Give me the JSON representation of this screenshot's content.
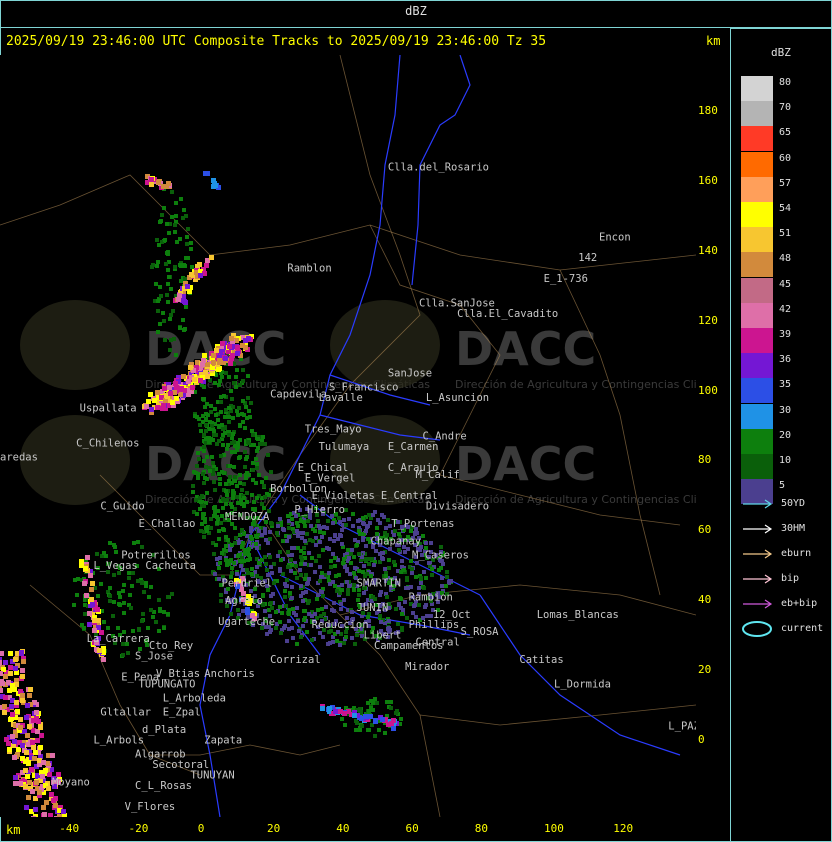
{
  "window": {
    "title": "dBZ"
  },
  "header": {
    "text": "2025/09/19 23:46:00 UTC Composite Tracks to 2025/09/19 23:46:00 Tz 35",
    "km_top": "km",
    "km_bottom": "km"
  },
  "axes": {
    "y_ticks": [
      "180",
      "160",
      "140",
      "120",
      "100",
      "80",
      "60",
      "40",
      "20",
      "0"
    ],
    "x_ticks": [
      "-40",
      "-20",
      "0",
      "20",
      "40",
      "60",
      "80",
      "100",
      "120"
    ]
  },
  "legend": {
    "title": "dBZ",
    "items": [
      {
        "label": "80",
        "color": "#d3d3d3"
      },
      {
        "label": "70",
        "color": "#b4b4b4"
      },
      {
        "label": "65",
        "color": "#ff3a26"
      },
      {
        "label": "60",
        "color": "#ff6a00"
      },
      {
        "label": "57",
        "color": "#ff9f5a"
      },
      {
        "label": "54",
        "color": "#ffff00"
      },
      {
        "label": "51",
        "color": "#f7c630"
      },
      {
        "label": "48",
        "color": "#d28a3c"
      },
      {
        "label": "45",
        "color": "#c26a86"
      },
      {
        "label": "42",
        "color": "#de6fa8"
      },
      {
        "label": "39",
        "color": "#cc1590"
      },
      {
        "label": "36",
        "color": "#7417d4"
      },
      {
        "label": "35",
        "color": "#2c4fe6"
      },
      {
        "label": "30",
        "color": "#1f92e6"
      },
      {
        "label": "20",
        "color": "#0d7f0d"
      },
      {
        "label": "10",
        "color": "#0a5f0a"
      },
      {
        "label": "5",
        "color": "#4b3f8f"
      }
    ],
    "tracks": [
      {
        "label": "50YD",
        "color": "#5fd7e6"
      },
      {
        "label": "30HM",
        "color": "#ffffff"
      },
      {
        "label": "eburn",
        "color": "#f2c88a"
      },
      {
        "label": "bip",
        "color": "#ffc6d6"
      },
      {
        "label": "eb+bip",
        "color": "#d05adc"
      },
      {
        "label": "current",
        "color": "#5fe6f0"
      }
    ]
  },
  "places": [
    {
      "name": "Clla.del_Rosario",
      "x": 52,
      "y": 163
    },
    {
      "name": "Encon",
      "x": 113,
      "y": 143
    },
    {
      "name": "142",
      "x": 107,
      "y": 137
    },
    {
      "name": "E_1-736",
      "x": 97,
      "y": 131
    },
    {
      "name": "Ramblon",
      "x": 23,
      "y": 134
    },
    {
      "name": "Clla.SanJose",
      "x": 61,
      "y": 124
    },
    {
      "name": "Clla.El_Cavadito",
      "x": 72,
      "y": 121
    },
    {
      "name": "SanJose",
      "x": 52,
      "y": 104
    },
    {
      "name": "S_Francisco",
      "x": 35,
      "y": 100
    },
    {
      "name": "L_Asuncion",
      "x": 63,
      "y": 97
    },
    {
      "name": "Lavalle",
      "x": 32,
      "y": 97
    },
    {
      "name": "Capdevila",
      "x": 18,
      "y": 98
    },
    {
      "name": "Uspallata",
      "x": -37,
      "y": 94
    },
    {
      "name": "Tres_Mayo",
      "x": 28,
      "y": 88
    },
    {
      "name": "C_Andre",
      "x": 62,
      "y": 86
    },
    {
      "name": "E_Carmen",
      "x": 52,
      "y": 83
    },
    {
      "name": "Tulumaya",
      "x": 32,
      "y": 83
    },
    {
      "name": "C_Chilenos",
      "x": -38,
      "y": 84
    },
    {
      "name": "C_Araujo",
      "x": 52,
      "y": 77
    },
    {
      "name": "E_Chical",
      "x": 26,
      "y": 77
    },
    {
      "name": "E_Vergel",
      "x": 28,
      "y": 74
    },
    {
      "name": "M_Calif",
      "x": 60,
      "y": 75
    },
    {
      "name": "Borbollon",
      "x": 18,
      "y": 71
    },
    {
      "name": "E_Violetas",
      "x": 30,
      "y": 69
    },
    {
      "name": "E_Central",
      "x": 50,
      "y": 69
    },
    {
      "name": "Divisadero",
      "x": 63,
      "y": 66
    },
    {
      "name": "MENDOZA",
      "x": 5,
      "y": 63
    },
    {
      "name": "P_Hierro",
      "x": 25,
      "y": 65
    },
    {
      "name": "C_Guido",
      "x": -31,
      "y": 66
    },
    {
      "name": "E_Challao",
      "x": -20,
      "y": 61
    },
    {
      "name": "T_Portenas",
      "x": 53,
      "y": 61
    },
    {
      "name": "Chapanay",
      "x": 47,
      "y": 56
    },
    {
      "name": "M_Caseros",
      "x": 59,
      "y": 52
    },
    {
      "name": "Potrerillos",
      "x": -25,
      "y": 52
    },
    {
      "name": "L_Vegas",
      "x": -33,
      "y": 49
    },
    {
      "name": "Cacheuta",
      "x": -18,
      "y": 49
    },
    {
      "name": "SMARTIN",
      "x": 43,
      "y": 44
    },
    {
      "name": "Perdriel",
      "x": 4,
      "y": 44
    },
    {
      "name": "Agrelo",
      "x": 5,
      "y": 39
    },
    {
      "name": "Rambion",
      "x": 58,
      "y": 40
    },
    {
      "name": "JUNIN",
      "x": 43,
      "y": 37
    },
    {
      "name": "Lomas_Blancas",
      "x": 95,
      "y": 35
    },
    {
      "name": "Phillips",
      "x": 58,
      "y": 32
    },
    {
      "name": "Ugarteche",
      "x": 3,
      "y": 33
    },
    {
      "name": "12_Oct",
      "x": 65,
      "y": 35
    },
    {
      "name": "S_ROSA",
      "x": 73,
      "y": 30
    },
    {
      "name": "Reduccion",
      "x": 30,
      "y": 32
    },
    {
      "name": "Libert",
      "x": 45,
      "y": 29
    },
    {
      "name": "Campamentos",
      "x": 48,
      "y": 26
    },
    {
      "name": "Central",
      "x": 60,
      "y": 27
    },
    {
      "name": "La_Carrera",
      "x": -35,
      "y": 28
    },
    {
      "name": "Cto_Rey",
      "x": -17,
      "y": 26
    },
    {
      "name": "S_Jose",
      "x": -21,
      "y": 23
    },
    {
      "name": "Catitas",
      "x": 90,
      "y": 22
    },
    {
      "name": "Corrizal",
      "x": 18,
      "y": 22
    },
    {
      "name": "Mirador",
      "x": 57,
      "y": 20
    },
    {
      "name": "Anchoris",
      "x": -1,
      "y": 18
    },
    {
      "name": "E_Pena",
      "x": -25,
      "y": 17
    },
    {
      "name": "V_Btias",
      "x": -15,
      "y": 18
    },
    {
      "name": "TUPUNGATO",
      "x": -20,
      "y": 15
    },
    {
      "name": "L_Arboleda",
      "x": -13,
      "y": 11
    },
    {
      "name": "L_Dormida",
      "x": 100,
      "y": 15
    },
    {
      "name": "Gltallar",
      "x": -31,
      "y": 7
    },
    {
      "name": "E_Zpal",
      "x": -13,
      "y": 7
    },
    {
      "name": "d_Plata",
      "x": -19,
      "y": 2
    },
    {
      "name": "L_Arbols",
      "x": -33,
      "y": -1
    },
    {
      "name": "Zapata",
      "x": -1,
      "y": -1
    },
    {
      "name": "L_PAZ",
      "x": 133,
      "y": 3
    },
    {
      "name": "Algarrob",
      "x": -21,
      "y": -5
    },
    {
      "name": "Secotoral",
      "x": -16,
      "y": -8
    },
    {
      "name": "TUNUYAN",
      "x": -5,
      "y": -11
    },
    {
      "name": "C_L_Rosas",
      "x": -21,
      "y": -14
    },
    {
      "name": "Moyano",
      "x": -45,
      "y": -13
    },
    {
      "name": "V_Flores",
      "x": -24,
      "y": -20
    },
    {
      "name": "aredas",
      "x": -60,
      "y": 80
    }
  ],
  "map": {
    "x_range": [
      -60,
      141
    ],
    "y_range": [
      -22,
      196
    ],
    "watermark_text": "DACC",
    "watermark_sub": "Dirección de Agricultura y Contingencias Climáticas"
  }
}
